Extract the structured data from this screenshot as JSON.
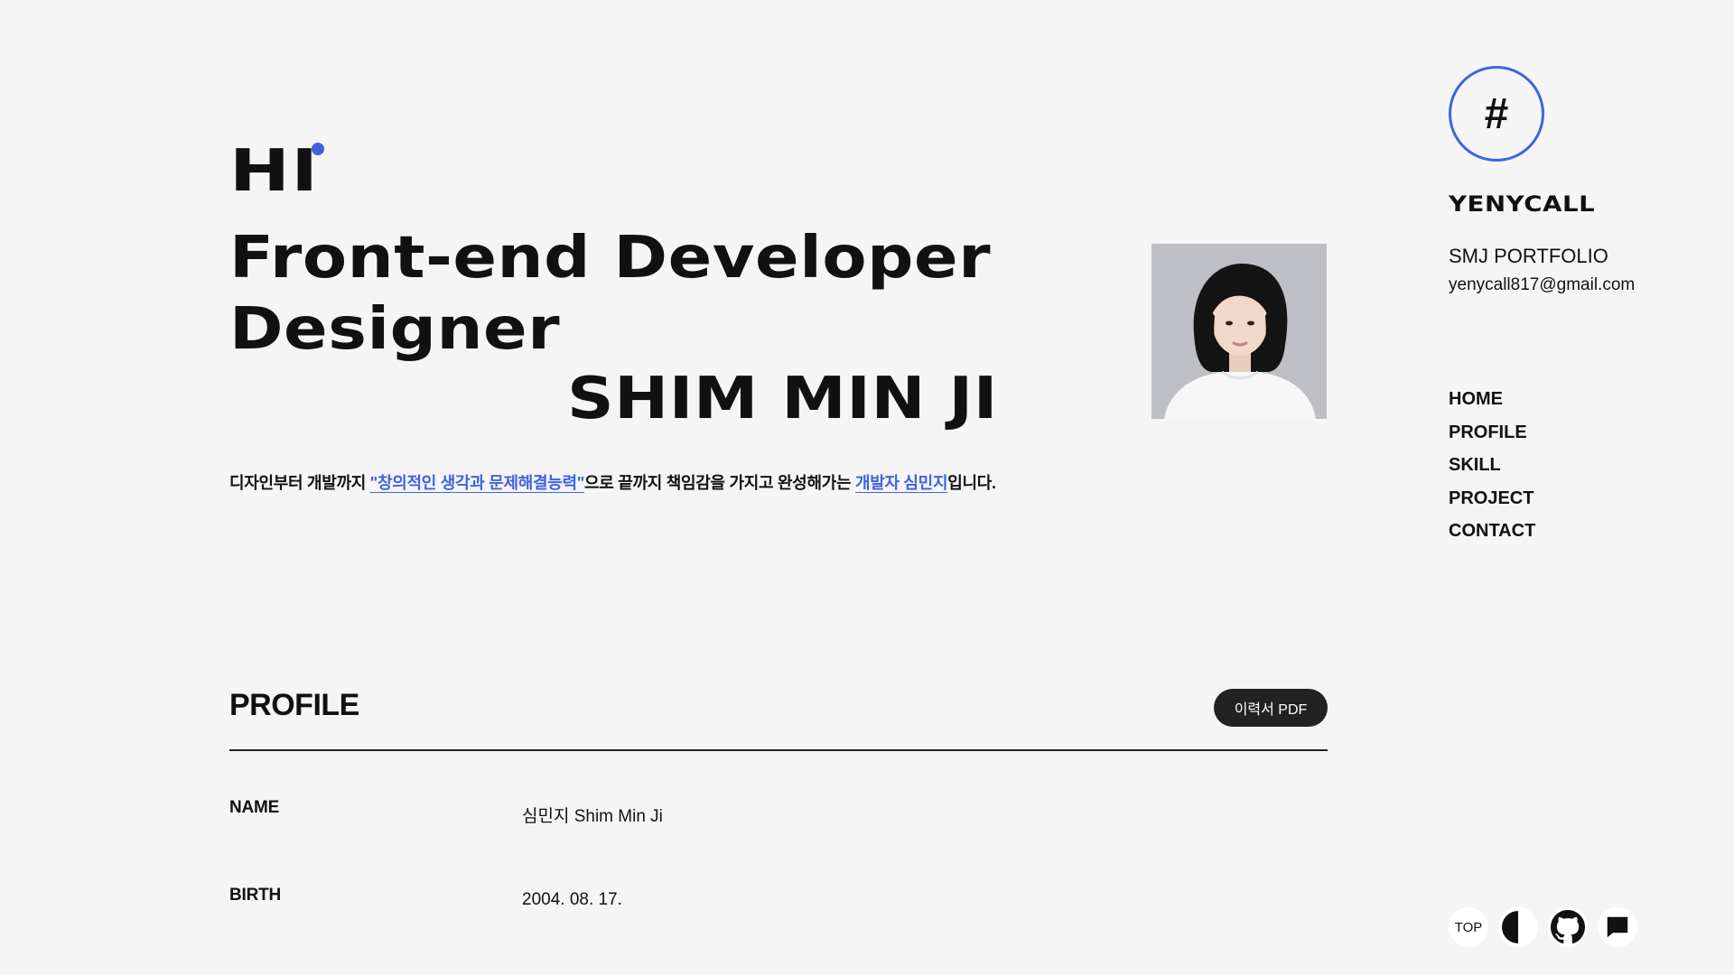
{
  "hero": {
    "hi": "HI",
    "line1": "Front-end Developer",
    "line2": "Designer",
    "name": "SHIM MIN JI"
  },
  "intro": {
    "part1": "디자인부터 개발까지 ",
    "highlight1": "\"창의적인 생각과 문제해결능력\"",
    "part2": "으로 끝까지 책임감을 가지고 완성해가는 ",
    "highlight2": "개발자 심민지",
    "part3": "입니다."
  },
  "profile": {
    "title": "PROFILE",
    "resume_button": "이력서 PDF",
    "rows": [
      {
        "label": "NAME",
        "value": "심민지 Shim Min Ji"
      },
      {
        "label": "BIRTH",
        "value": "2004. 08. 17."
      }
    ]
  },
  "sidebar": {
    "logo": "#",
    "brand": "YENYCALL",
    "subtitle": "SMJ PORTFOLIO",
    "email": "yenycall817@gmail.com",
    "nav": [
      "HOME",
      "PROFILE",
      "SKILL",
      "PROJECT",
      "CONTACT"
    ]
  },
  "floating": {
    "top_label": "TOP",
    "theme_icon": "contrast-icon",
    "github_icon": "github-icon",
    "chat_icon": "chat-icon"
  },
  "colors": {
    "accent": "#3f63e0",
    "background": "#f5f5f5",
    "text": "#111111"
  }
}
